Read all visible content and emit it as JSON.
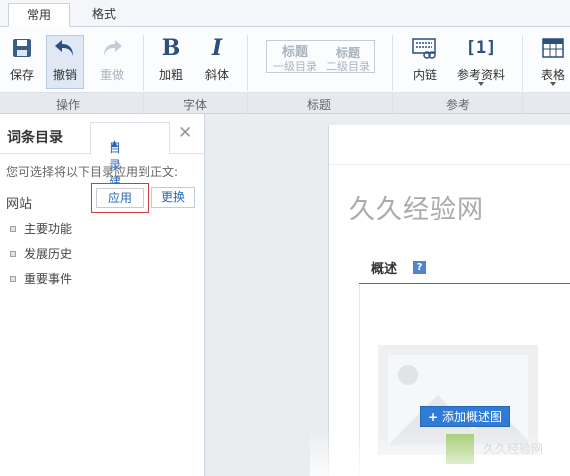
{
  "tabs": [
    {
      "label": "常用",
      "active": true
    },
    {
      "label": "格式",
      "active": false
    }
  ],
  "ribbon": {
    "save": "保存",
    "undo": "撤销",
    "redo": "重做",
    "bold": "加粗",
    "bold_glyph": "B",
    "italic": "斜体",
    "italic_glyph": "I",
    "heading1_top": "标题",
    "heading1_bottom": "一级目录",
    "heading2_top": "标题",
    "heading2_bottom": "二级目录",
    "inner_link": "内链",
    "reference": "参考资料",
    "reference_glyph": "[1]",
    "table": "表格"
  },
  "groups": {
    "operation": "操作",
    "font": "字体",
    "heading": "标题",
    "reference": "参考"
  },
  "sidebar": {
    "title": "词条目录",
    "active_tab": "目录建议",
    "description": "您可选择将以下目录应用到正文:",
    "site_label": "网站",
    "apply_label": "应用",
    "change_label": "更换",
    "items": [
      {
        "label": "主要功能"
      },
      {
        "label": "发展历史"
      },
      {
        "label": "重要事件"
      }
    ]
  },
  "editor": {
    "entry_title": "久久经验网",
    "overview_label": "概述",
    "help_glyph": "?",
    "add_image_label": "添加概述图",
    "watermark": "久久经验网"
  },
  "colors": {
    "accent": "#2f7bd6",
    "link": "#2b67b3",
    "highlight_border": "#d23a3a"
  }
}
